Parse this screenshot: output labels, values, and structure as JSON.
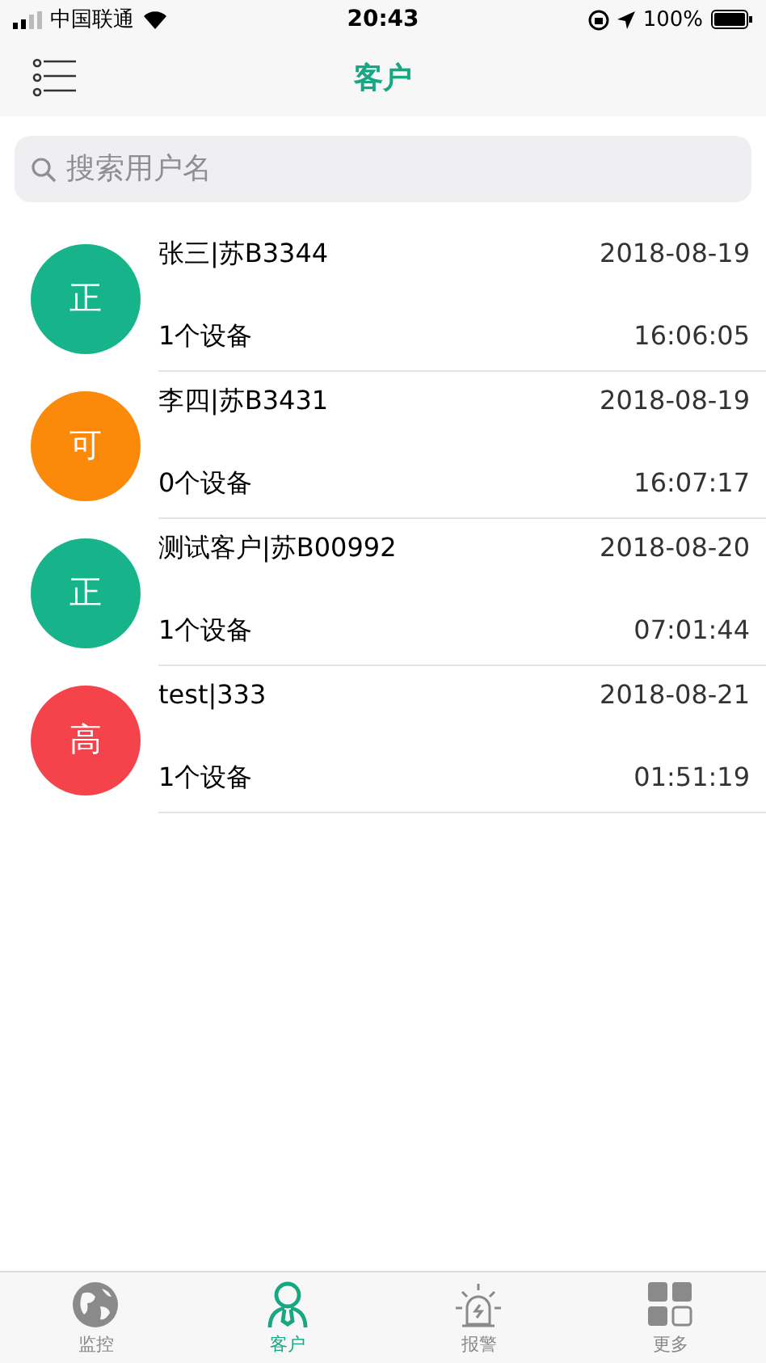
{
  "status_bar": {
    "carrier": "中国联通",
    "time": "20:43",
    "battery": "100%"
  },
  "nav": {
    "title": "客户"
  },
  "search": {
    "placeholder": "搜索用户名"
  },
  "customers": [
    {
      "badge": "正",
      "color": "#17b48c",
      "name": "张三|苏B3344",
      "date": "2018-08-19",
      "devices": "1个设备",
      "time": "16:06:05"
    },
    {
      "badge": "可",
      "color": "#fb8a0a",
      "name": "李四|苏B3431",
      "date": "2018-08-19",
      "devices": "0个设备",
      "time": "16:07:17"
    },
    {
      "badge": "正",
      "color": "#17b48c",
      "name": "测试客户|苏B00992",
      "date": "2018-08-20",
      "devices": "1个设备",
      "time": "07:01:44"
    },
    {
      "badge": "高",
      "color": "#f5434b",
      "name": "test|333",
      "date": "2018-08-21",
      "devices": "1个设备",
      "time": "01:51:19"
    }
  ],
  "tabs": [
    {
      "kind": "globe",
      "label": "监控",
      "selected": false
    },
    {
      "kind": "person",
      "label": "客户",
      "selected": true
    },
    {
      "kind": "alarm",
      "label": "报警",
      "selected": false
    },
    {
      "kind": "grid",
      "label": "更多",
      "selected": false
    }
  ]
}
